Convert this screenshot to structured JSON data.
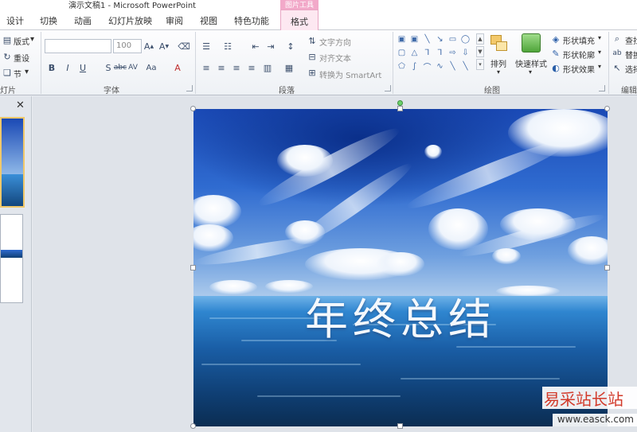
{
  "window": {
    "title": "演示文稿1 - Microsoft PowerPoint",
    "context_tab_group": "图片工具"
  },
  "tabs": [
    {
      "label": "设计"
    },
    {
      "label": "切换"
    },
    {
      "label": "动画"
    },
    {
      "label": "幻灯片放映"
    },
    {
      "label": "审阅"
    },
    {
      "label": "视图"
    },
    {
      "label": "特色功能"
    },
    {
      "label": "格式"
    }
  ],
  "ribbon": {
    "slides_group": {
      "layout": "版式",
      "reset": "重设",
      "section": "节",
      "label": "灯片"
    },
    "font_group": {
      "font_name": "",
      "font_size": "100",
      "label": "字体"
    },
    "paragraph_group": {
      "text_direction": "文字方向",
      "align_text": "对齐文本",
      "convert_smartart": "转换为 SmartArt",
      "label": "段落"
    },
    "drawing_group": {
      "arrange": "排列",
      "quick_styles": "快速样式",
      "shape_fill": "形状填充",
      "shape_outline": "形状轮廓",
      "shape_effects": "形状效果",
      "label": "绘图"
    },
    "editing_group": {
      "find": "查找",
      "replace": "替换",
      "select": "选择",
      "label": "编辑"
    }
  },
  "slide": {
    "title_text": "年终总结"
  },
  "watermark": {
    "site_name": "易采站长站",
    "url": "www.easck.com"
  },
  "colors": {
    "accent_tab": "#e9a7c4",
    "selection_highlight": "#f1c86a",
    "watermark_red": "#d23a2a"
  }
}
